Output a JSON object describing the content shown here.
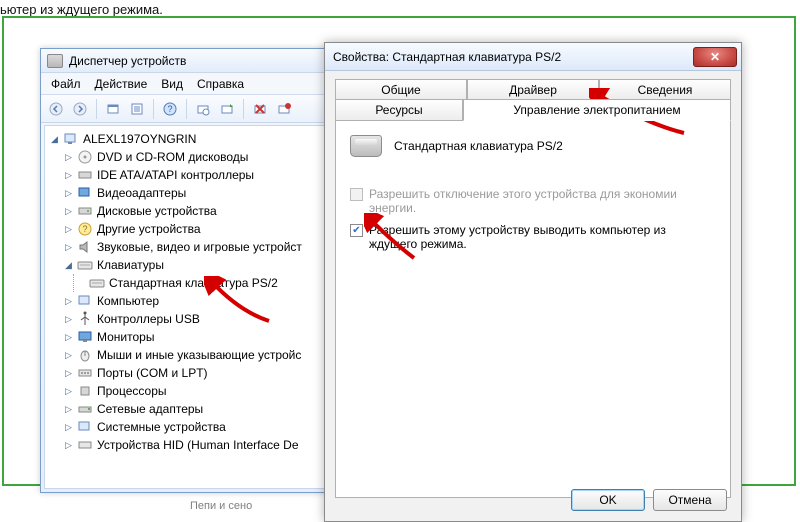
{
  "fragment_text": "ьютер из ждущего режима.",
  "devmgr": {
    "title": "Диспетчер устройств",
    "menu": {
      "file": "Файл",
      "action": "Действие",
      "view": "Вид",
      "help": "Справка"
    },
    "root": "ALEXL197OYNGRIN",
    "items": [
      "DVD и CD-ROM дисководы",
      "IDE ATA/ATAPI контроллеры",
      "Видеоадаптеры",
      "Дисковые устройства",
      "Другие устройства",
      "Звуковые, видео и игровые устройст",
      "Клавиатуры",
      "Компьютер",
      "Контроллеры USB",
      "Мониторы",
      "Мыши и иные указывающие устройс",
      "Порты (COM и LPT)",
      "Процессоры",
      "Сетевые адаптеры",
      "Системные устройства",
      "Устройства HID (Human Interface De"
    ],
    "keyboard_child": "Стандартная клавиатура PS/2"
  },
  "props": {
    "title": "Свойства: Стандартная клавиатура PS/2",
    "tabs": {
      "general": "Общие",
      "driver": "Драйвер",
      "details": "Сведения",
      "resources": "Ресурсы",
      "power": "Управление электропитанием"
    },
    "device_name": "Стандартная клавиатура PS/2",
    "chk1": "Разрешить отключение этого устройства для экономии энергии.",
    "chk2": "Разрешить этому устройству выводить компьютер из ждущего режима.",
    "ok": "OK",
    "cancel": "Отмена"
  },
  "truncated_footer": "Пепи и сено"
}
